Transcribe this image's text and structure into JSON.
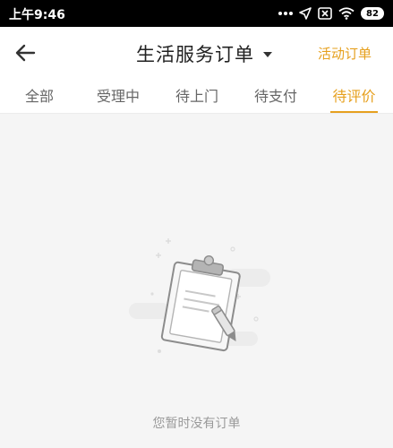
{
  "status_bar": {
    "time": "上午9:46",
    "battery": "82",
    "icons": [
      "dots-icon",
      "location-arrow-icon",
      "sim-off-icon",
      "wifi-icon",
      "battery-icon"
    ]
  },
  "header": {
    "title": "生活服务订单",
    "action_label": "活动订单",
    "back_icon": "back-arrow-icon",
    "dropdown_icon": "caret-down-icon"
  },
  "tabs": [
    {
      "label": "全部",
      "active": false
    },
    {
      "label": "受理中",
      "active": false
    },
    {
      "label": "待上门",
      "active": false
    },
    {
      "label": "待支付",
      "active": false
    },
    {
      "label": "待评价",
      "active": true
    }
  ],
  "empty_state": {
    "message": "您暂时没有订单",
    "icon": "clipboard-pen-icon"
  },
  "colors": {
    "accent": "#e6a01e",
    "background": "#f5f5f5",
    "status_bar": "#000000"
  }
}
